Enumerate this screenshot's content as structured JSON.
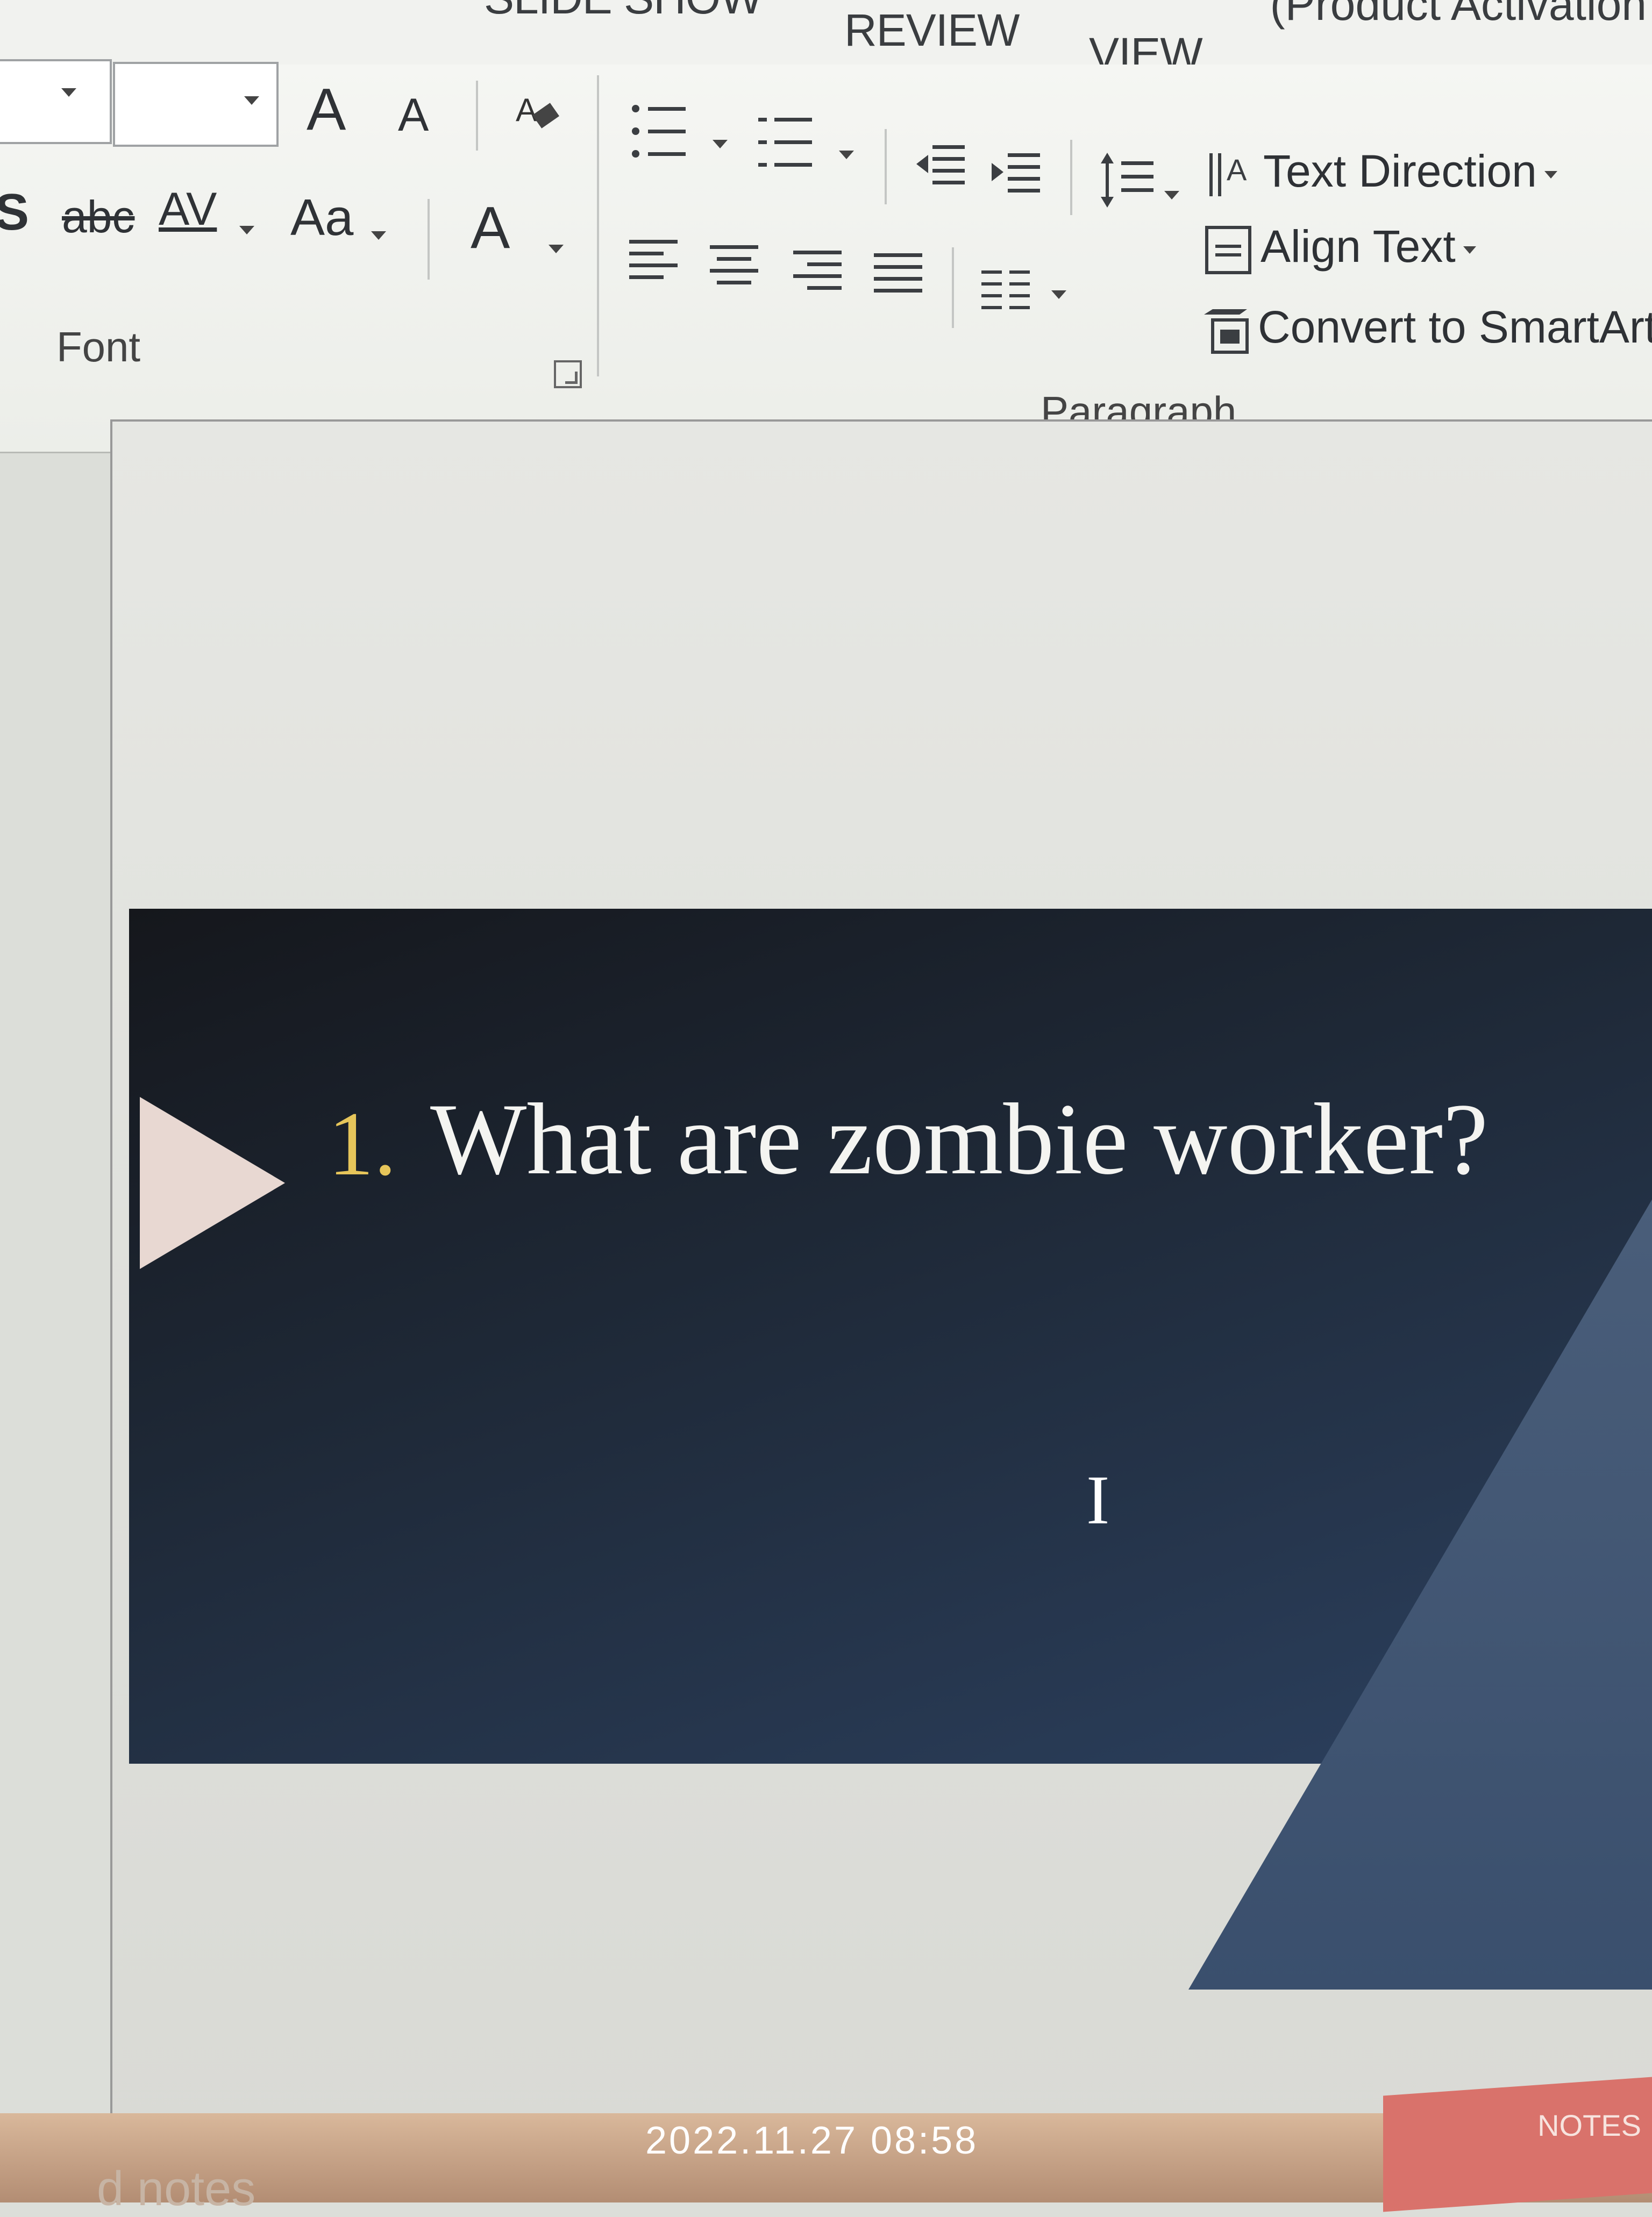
{
  "tabs": {
    "slide_show": "SLIDE SHOW",
    "review": "REVIEW",
    "view": "VIEW",
    "product_activation": "(Product Activation"
  },
  "ribbon": {
    "font_group_label": "Font",
    "paragraph_group_label": "Paragraph",
    "text_direction": "Text Direction",
    "align_text": "Align Text",
    "convert_smartart": "Convert to SmartArt",
    "increase_font_icon": "A",
    "decrease_font_icon": "A",
    "strikethrough_label": "abc",
    "char_spacing_label": "AV",
    "change_case_label": "Aa",
    "font_color_label": "A",
    "s_label": "S"
  },
  "slide": {
    "number": "1.",
    "title": "What are zombie worker?"
  },
  "statusbar": {
    "notes": "NOTES",
    "notes_placeholder": "d notes"
  },
  "overlay": {
    "timestamp": "2022.11.27 08:58"
  }
}
